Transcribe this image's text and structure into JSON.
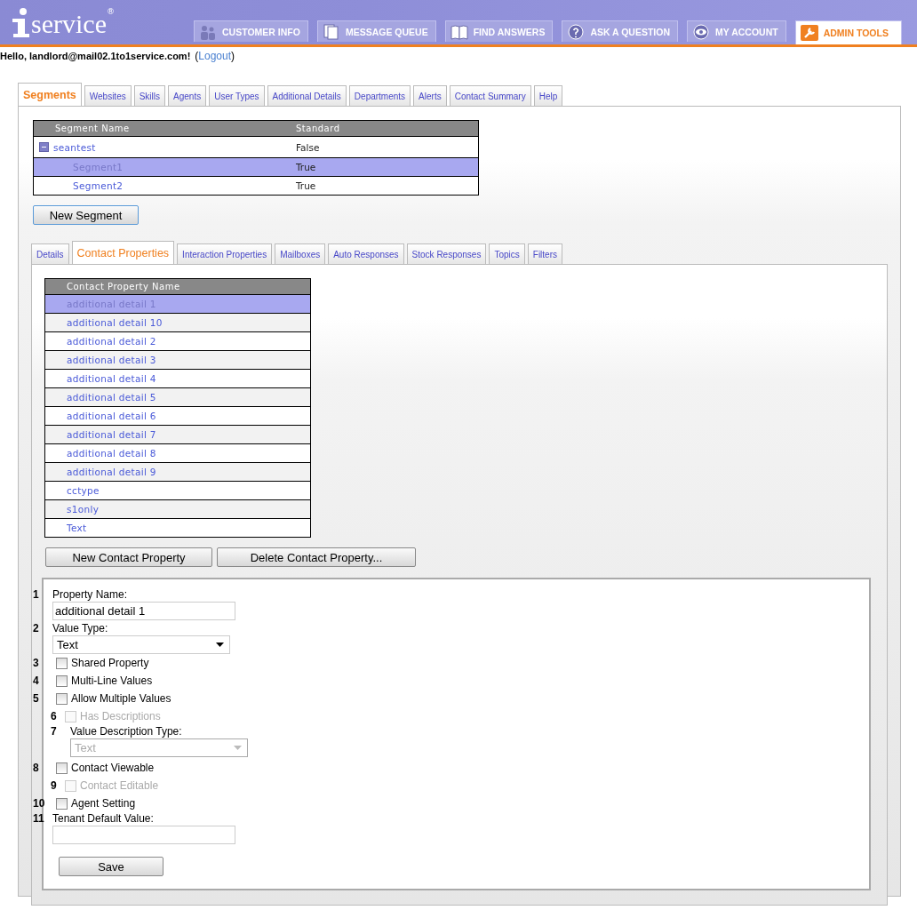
{
  "logo": {
    "text": "service",
    "mark": "®"
  },
  "nav": [
    {
      "label": "CUSTOMER INFO",
      "selected": false
    },
    {
      "label": "MESSAGE QUEUE",
      "selected": false
    },
    {
      "label": "FIND ANSWERS",
      "selected": false
    },
    {
      "label": "ASK A QUESTION",
      "selected": false
    },
    {
      "label": "MY ACCOUNT",
      "selected": false
    },
    {
      "label": "ADMIN TOOLS",
      "selected": true
    }
  ],
  "greeting": {
    "text": "Hello, landlord@mail02.1to1service.com!",
    "open": "(",
    "link": "Logout",
    "close": ")"
  },
  "tabs": [
    {
      "label": "Segments",
      "selected": true
    },
    {
      "label": "Websites",
      "selected": false
    },
    {
      "label": "Skills",
      "selected": false
    },
    {
      "label": "Agents",
      "selected": false
    },
    {
      "label": "User Types",
      "selected": false
    },
    {
      "label": "Additional Details",
      "selected": false
    },
    {
      "label": "Departments",
      "selected": false
    },
    {
      "label": "Alerts",
      "selected": false
    },
    {
      "label": "Contact Summary",
      "selected": false
    },
    {
      "label": "Help",
      "selected": false
    }
  ],
  "segments": {
    "columns": [
      "Segment Name",
      "Standard"
    ],
    "rows": [
      {
        "name": "seantest",
        "standard": "False",
        "selected": false,
        "expanded": true,
        "children": [
          {
            "name": "Segment1",
            "standard": "True",
            "selected": true
          },
          {
            "name": "Segment2",
            "standard": "True",
            "selected": false
          }
        ]
      }
    ]
  },
  "new_segment_button": "New Segment",
  "subtabs": [
    {
      "label": "Details",
      "selected": false
    },
    {
      "label": "Contact Properties",
      "selected": true
    },
    {
      "label": "Interaction Properties",
      "selected": false
    },
    {
      "label": "Mailboxes",
      "selected": false
    },
    {
      "label": "Auto Responses",
      "selected": false
    },
    {
      "label": "Stock Responses",
      "selected": false
    },
    {
      "label": "Topics",
      "selected": false
    },
    {
      "label": "Filters",
      "selected": false
    }
  ],
  "properties": {
    "column": "Contact Property Name",
    "rows": [
      {
        "name": "additional detail 1",
        "selected": true
      },
      {
        "name": "additional detail 10",
        "selected": false
      },
      {
        "name": "additional detail 2",
        "selected": false
      },
      {
        "name": "additional detail 3",
        "selected": false
      },
      {
        "name": "additional detail 4",
        "selected": false
      },
      {
        "name": "additional detail 5",
        "selected": false
      },
      {
        "name": "additional detail 6",
        "selected": false
      },
      {
        "name": "additional detail 7",
        "selected": false
      },
      {
        "name": "additional detail 8",
        "selected": false
      },
      {
        "name": "additional detail 9",
        "selected": false
      },
      {
        "name": "cctype",
        "selected": false
      },
      {
        "name": "s1only",
        "selected": false
      },
      {
        "name": "Text",
        "selected": false
      }
    ]
  },
  "property_buttons": [
    "New Contact Property",
    "Delete Contact Property..."
  ],
  "form": [
    {
      "number": "1",
      "kind": "text",
      "label": "Property Name:",
      "value": "additional detail 1"
    },
    {
      "number": "2",
      "kind": "select",
      "label": "Value Type:",
      "value": "Text",
      "disabled": false
    },
    {
      "number": "3",
      "kind": "checkbox",
      "label": "Shared Property",
      "checked": false,
      "disabled": false
    },
    {
      "number": "4",
      "kind": "checkbox",
      "label": "Multi-Line Values",
      "checked": false,
      "disabled": false
    },
    {
      "number": "5",
      "kind": "checkbox",
      "label": "Allow Multiple Values",
      "checked": false,
      "disabled": false
    },
    {
      "number": "6",
      "kind": "checkbox",
      "label": "Has Descriptions",
      "checked": false,
      "disabled": true
    },
    {
      "number": "7",
      "kind": "select",
      "label": "Value Description Type:",
      "value": "Text",
      "disabled": true
    },
    {
      "number": "8",
      "kind": "checkbox",
      "label": "Contact Viewable",
      "checked": false,
      "disabled": false
    },
    {
      "number": "9",
      "kind": "checkbox",
      "label": "Contact Editable",
      "checked": false,
      "disabled": true
    },
    {
      "number": "10",
      "kind": "checkbox",
      "label": "Agent Setting",
      "checked": false,
      "disabled": false
    },
    {
      "number": "11",
      "kind": "text",
      "label": "Tenant Default Value:"
    }
  ],
  "save_button": "Save"
}
